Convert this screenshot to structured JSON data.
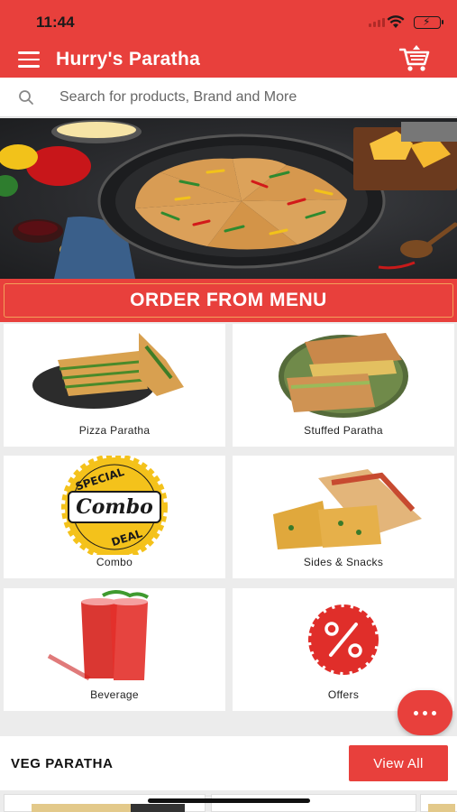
{
  "status_bar": {
    "time": "11:44"
  },
  "app_bar": {
    "title": "Hurry's Paratha",
    "menu_icon": "hamburger-menu-icon",
    "cart_icon": "shopping-cart-icon"
  },
  "search": {
    "placeholder": "Search for products, Brand and More",
    "value": ""
  },
  "banner": {
    "alt": "pizza-paratha-banner-image"
  },
  "order_menu": {
    "label": "ORDER FROM MENU"
  },
  "categories": [
    {
      "label": "Pizza Paratha"
    },
    {
      "label": "Stuffed Paratha"
    },
    {
      "label": "Combo",
      "badge_lines": [
        "SPECIAL",
        "Combo",
        "DEAL"
      ]
    },
    {
      "label": "Sides & Snacks"
    },
    {
      "label": "Beverage"
    },
    {
      "label": "Offers"
    }
  ],
  "section": {
    "title": "VEG PARATHA",
    "view_all": "View All"
  },
  "colors": {
    "brand_red": "#e8403c",
    "offer_red": "#e02e2a",
    "combo_yellow": "#f4c21b"
  }
}
